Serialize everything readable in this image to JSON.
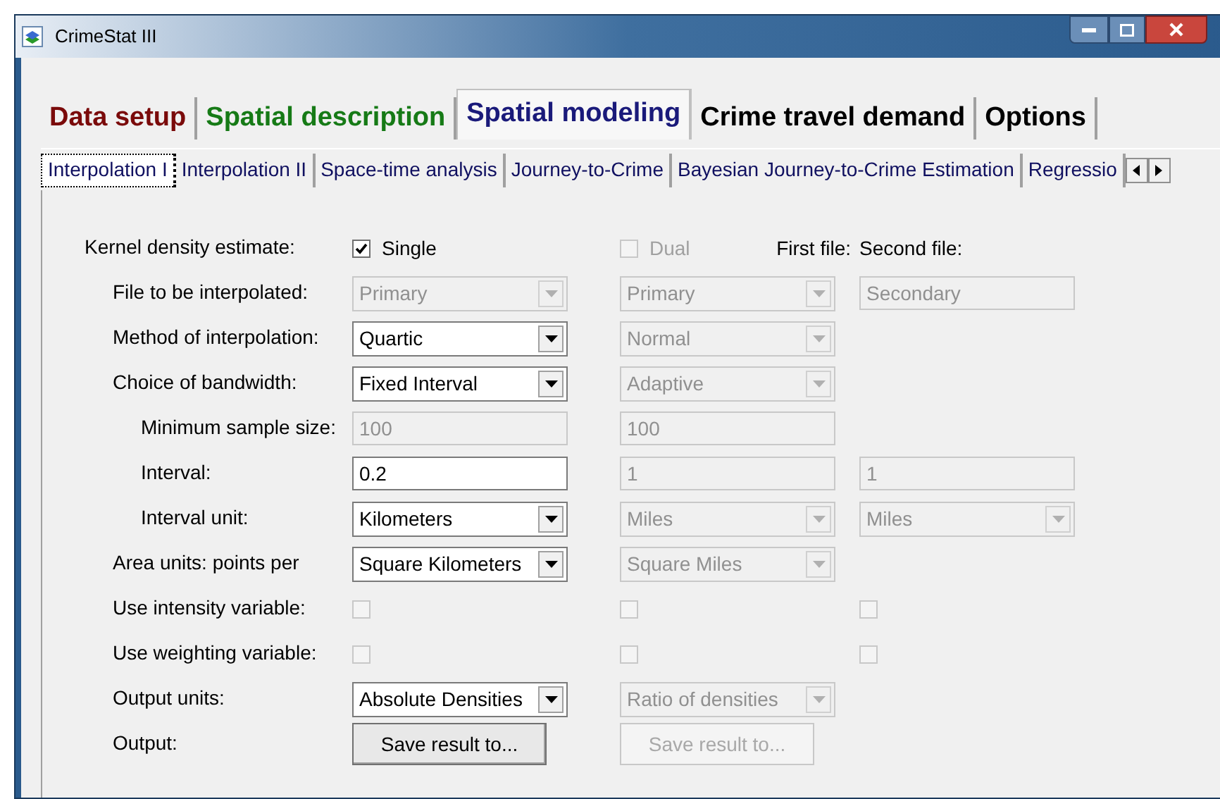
{
  "window": {
    "title": "CrimeStat III"
  },
  "tabs": [
    {
      "label": "Data setup",
      "color": "#7a0a0a",
      "selected": false
    },
    {
      "label": "Spatial description",
      "color": "#167a16",
      "selected": false
    },
    {
      "label": "Spatial modeling",
      "color": "#1a1a7a",
      "selected": true
    },
    {
      "label": "Crime travel demand",
      "color": "#000000",
      "selected": false
    },
    {
      "label": "Options",
      "color": "#000000",
      "selected": false
    }
  ],
  "subtabs": [
    {
      "label": "Interpolation I",
      "selected": true
    },
    {
      "label": "Interpolation II",
      "selected": false
    },
    {
      "label": "Space-time analysis",
      "selected": false
    },
    {
      "label": "Journey-to-Crime",
      "selected": false
    },
    {
      "label": "Bayesian Journey-to-Crime Estimation",
      "selected": false
    },
    {
      "label": "Regressio",
      "selected": false
    }
  ],
  "form": [
    {
      "label": "Kernel density estimate:",
      "columns": [
        [
          {
            "kind": "check",
            "label": "Single",
            "checked": true,
            "disabled": false
          }
        ],
        [
          {
            "kind": "check",
            "label": "Dual",
            "checked": false,
            "disabled": true
          },
          {
            "kind": "header",
            "text": "First file:"
          }
        ],
        [
          {
            "kind": "header",
            "text": "Second file:"
          }
        ]
      ],
      "children": [
        {
          "label": "File to be interpolated:",
          "columns": [
            [
              {
                "kind": "combo",
                "value": "Primary",
                "disabled": true
              }
            ],
            [
              {
                "kind": "combo",
                "value": "Primary",
                "disabled": true
              }
            ],
            [
              {
                "kind": "text",
                "value": "Secondary",
                "disabled": true
              }
            ]
          ]
        },
        {
          "label": "Method of interpolation:",
          "columns": [
            [
              {
                "kind": "combo",
                "value": "Quartic",
                "disabled": false
              }
            ],
            [
              {
                "kind": "combo",
                "value": "Normal",
                "disabled": true
              }
            ]
          ]
        },
        {
          "label": "Choice of bandwidth:",
          "columns": [
            [
              {
                "kind": "combo",
                "value": "Fixed Interval",
                "disabled": false
              }
            ],
            [
              {
                "kind": "combo",
                "value": "Adaptive",
                "disabled": true
              }
            ]
          ],
          "children": [
            {
              "label": "Minimum sample size:",
              "columns": [
                [
                  {
                    "kind": "text",
                    "value": "100",
                    "disabled": true
                  }
                ],
                [
                  {
                    "kind": "text",
                    "value": "100",
                    "disabled": true
                  }
                ]
              ]
            },
            {
              "label": "Interval:",
              "columns": [
                [
                  {
                    "kind": "text",
                    "value": "0.2",
                    "disabled": false
                  }
                ],
                [
                  {
                    "kind": "text",
                    "value": "1",
                    "disabled": true
                  }
                ],
                [
                  {
                    "kind": "text",
                    "value": "1",
                    "disabled": true
                  }
                ]
              ]
            },
            {
              "label": "Interval unit:",
              "columns": [
                [
                  {
                    "kind": "combo",
                    "value": "Kilometers",
                    "disabled": false
                  }
                ],
                [
                  {
                    "kind": "combo",
                    "value": "Miles",
                    "disabled": true
                  }
                ],
                [
                  {
                    "kind": "combo",
                    "value": "Miles",
                    "disabled": true
                  }
                ]
              ]
            }
          ]
        },
        {
          "label": "Area units: points per",
          "columns": [
            [
              {
                "kind": "combo",
                "value": "Square Kilometers",
                "disabled": false
              }
            ],
            [
              {
                "kind": "combo",
                "value": "Square Miles",
                "disabled": true
              }
            ]
          ]
        },
        {
          "label": "Use intensity variable:",
          "columns": [
            [
              {
                "kind": "check",
                "checked": false,
                "disabled": true
              }
            ],
            [
              {
                "kind": "check",
                "checked": false,
                "disabled": true
              }
            ],
            [
              {
                "kind": "check",
                "checked": false,
                "disabled": true
              }
            ]
          ]
        },
        {
          "label": "Use weighting variable:",
          "columns": [
            [
              {
                "kind": "check",
                "checked": false,
                "disabled": true
              }
            ],
            [
              {
                "kind": "check",
                "checked": false,
                "disabled": true
              }
            ],
            [
              {
                "kind": "check",
                "checked": false,
                "disabled": true
              }
            ]
          ]
        },
        {
          "label": "Output units:",
          "columns": [
            [
              {
                "kind": "combo",
                "value": "Absolute Densities",
                "disabled": false
              }
            ],
            [
              {
                "kind": "combo",
                "value": "Ratio of densities",
                "disabled": true
              }
            ]
          ]
        },
        {
          "label": "Output:",
          "columns": [
            [
              {
                "kind": "button",
                "label": "Save result to...",
                "disabled": false
              }
            ],
            [
              {
                "kind": "button",
                "label": "Save result to...",
                "disabled": true
              }
            ]
          ]
        }
      ]
    }
  ]
}
